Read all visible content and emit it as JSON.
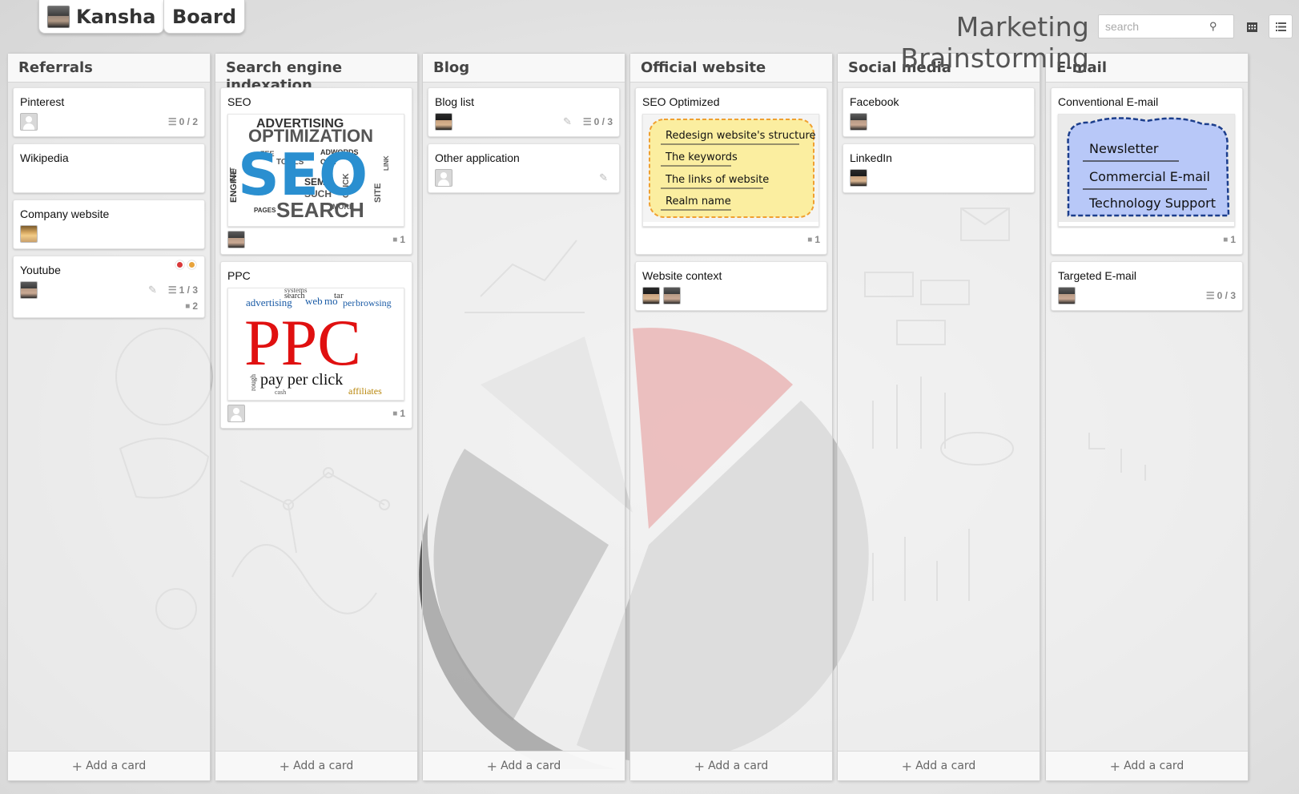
{
  "header": {
    "user_name": "Kansha",
    "board_tab": "Board",
    "board_title": "Marketing Brainstorming",
    "search_placeholder": "search",
    "search_icon": "magnifier-icon",
    "view_icons": [
      "calendar-icon",
      "list-icon"
    ]
  },
  "lists": [
    {
      "title": "Referrals",
      "add_label": "Add a card",
      "cards": [
        {
          "title": "Pinterest",
          "members": [
            "placeholder"
          ],
          "checklist": "0 / 2"
        },
        {
          "title": "Wikipedia",
          "members": []
        },
        {
          "title": "Company website",
          "members": [
            "photo3"
          ]
        },
        {
          "title": "Youtube",
          "members": [
            "photo1"
          ],
          "checklist": "1 / 3",
          "attachments": "2",
          "labels": [
            "#d9383a",
            "#e8a33b"
          ],
          "editable": true
        }
      ]
    },
    {
      "title": "Search engine indexation",
      "add_label": "Add a card",
      "cards": [
        {
          "title": "SEO",
          "members": [
            "photo1"
          ],
          "attachments": "1",
          "image": {
            "kind": "word-cloud-seo",
            "big": "SEO",
            "words": [
              "ADVERTISING",
              "OPTIMIZATION",
              "SEARCH",
              "ENGINE",
              "SITE",
              "TOOLS",
              "SEM",
              "CLICK",
              "MORE",
              "PAGES",
              "EDIT",
              "LINK",
              "ADWORDS",
              "SUCH",
              "FEE",
              "ONE"
            ]
          }
        },
        {
          "title": "PPC",
          "members": [
            "placeholder"
          ],
          "attachments": "1",
          "image": {
            "kind": "word-cloud-ppc",
            "big": "PPC",
            "sub": "pay per click",
            "words": [
              "advertising",
              "search",
              "web",
              "mo",
              "tar",
              "per",
              "browsing",
              "systems",
              "affiliates",
              "cash",
              "rough"
            ]
          }
        }
      ]
    },
    {
      "title": "Blog",
      "add_label": "Add a card",
      "cards": [
        {
          "title": "Blog list",
          "members": [
            "photo2"
          ],
          "checklist": "0 / 3",
          "editable": true
        },
        {
          "title": "Other application",
          "members": [
            "placeholder"
          ],
          "editable": true
        }
      ]
    },
    {
      "title": "Official website",
      "add_label": "Add a card",
      "cards": [
        {
          "title": "SEO Optimized",
          "members": [],
          "attachments": "1",
          "image": {
            "kind": "note-yellow",
            "lines": [
              "Redesign website's structure",
              "The keywords",
              "The links of website",
              "Realm name"
            ]
          }
        },
        {
          "title": "Website context",
          "members": [
            "photo2",
            "photo1"
          ]
        }
      ]
    },
    {
      "title": "Social media",
      "add_label": "Add a card",
      "cards": [
        {
          "title": "Facebook",
          "members": [
            "photo1"
          ]
        },
        {
          "title": "LinkedIn",
          "members": [
            "photo2"
          ]
        }
      ]
    },
    {
      "title": "E-mail",
      "add_label": "Add a card",
      "cards": [
        {
          "title": "Conventional E-mail",
          "members": [],
          "attachments": "1",
          "image": {
            "kind": "note-cloud",
            "lines": [
              "Newsletter",
              "Commercial E-mail",
              "Technology Support"
            ]
          }
        },
        {
          "title": "Targeted E-mail",
          "members": [
            "photo1"
          ],
          "checklist": "0 / 3"
        }
      ]
    }
  ],
  "colors": {
    "seo_blue": "#2a8fd0",
    "ppc_red": "#e01010",
    "note_yellow": "#fbeea0",
    "note_border": "#f0a030",
    "cloud_blue": "#b8c8f8",
    "cloud_border": "#1c3e8c"
  }
}
